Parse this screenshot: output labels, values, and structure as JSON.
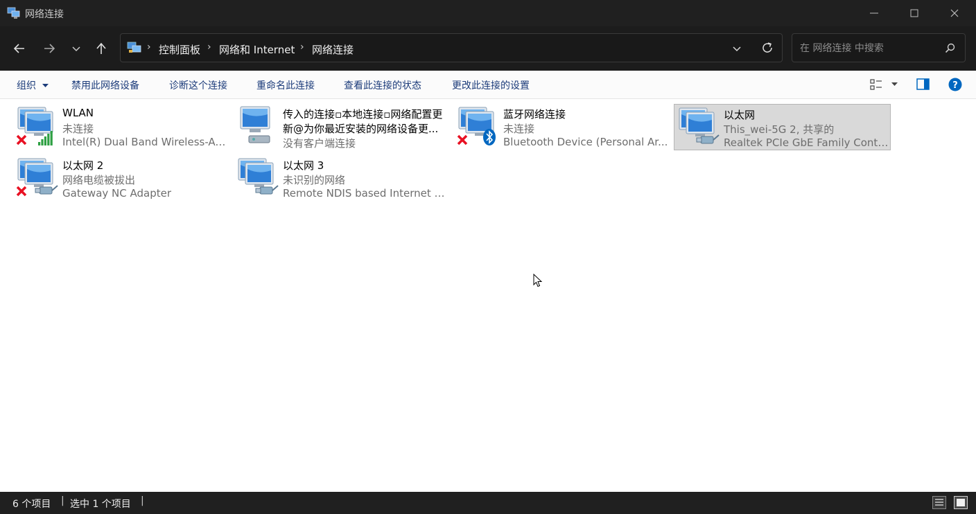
{
  "window": {
    "title": "网络连接",
    "min_glyph": "—",
    "max_glyph": "☐",
    "close_glyph": "✕"
  },
  "address": {
    "crumbs": [
      "控制面板",
      "网络和 Internet",
      "网络连接"
    ],
    "separator": "›"
  },
  "search": {
    "placeholder": "在 网络连接 中搜索"
  },
  "commands": {
    "organize": "组织",
    "disable": "禁用此网络设备",
    "diagnose": "诊断这个连接",
    "rename": "重命名此连接",
    "view_status": "查看此连接的状态",
    "change_settings": "更改此连接的设置"
  },
  "connections": [
    {
      "name": "WLAN",
      "status": "未连接",
      "device": "Intel(R) Dual Band Wireless-AC...",
      "icon": "wifi-adapter-icon",
      "disconnected": true,
      "selected": false
    },
    {
      "name": "传入的连接▫本地连接▫网络配置更",
      "status": "新@为你最近安装的网络设备更...",
      "device": "没有客户端连接",
      "icon": "incoming-connection-icon",
      "disconnected": false,
      "selected": false
    },
    {
      "name": "蓝牙网络连接",
      "status": "未连接",
      "device": "Bluetooth Device (Personal Ar...",
      "icon": "bluetooth-adapter-icon",
      "disconnected": true,
      "selected": false
    },
    {
      "name": "以太网",
      "status": "This_wei-5G 2, 共享的",
      "device": "Realtek PCIe GbE Family Contr...",
      "icon": "ethernet-adapter-icon",
      "disconnected": false,
      "selected": true
    },
    {
      "name": "以太网 2",
      "status": "网络电缆被拔出",
      "device": "Gateway NC Adapter",
      "icon": "ethernet-adapter-icon",
      "disconnected": true,
      "selected": false
    },
    {
      "name": "以太网 3",
      "status": "未识别的网络",
      "device": "Remote NDIS based Internet S...",
      "icon": "ethernet-adapter-icon",
      "disconnected": false,
      "selected": false
    }
  ],
  "status": {
    "item_count": "6 个项目",
    "selected_count": "选中 1 个项目"
  },
  "colors": {
    "accent": "#0067c0",
    "title_bar": "#202020",
    "selected_tile": "#d9d9d9",
    "disconnect_red": "#e81123"
  }
}
